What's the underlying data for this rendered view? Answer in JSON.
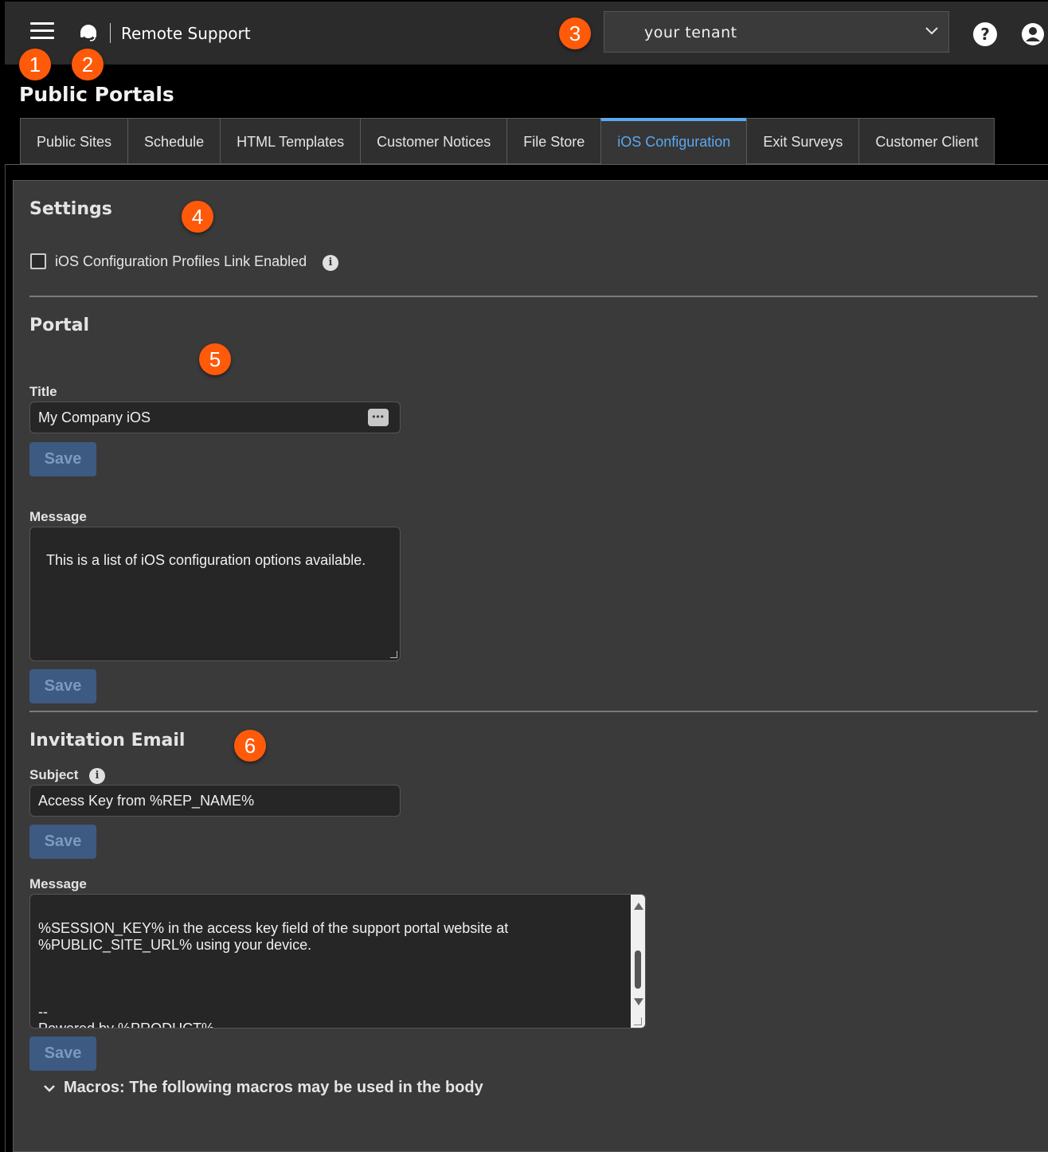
{
  "header": {
    "app_title": "Remote Support",
    "tenant": "your tenant",
    "help_icon": "?",
    "icons": [
      "menu-icon",
      "headset-logo-icon",
      "chevron-down-icon",
      "help-icon",
      "user-account-icon"
    ]
  },
  "badges": [
    "1",
    "2",
    "3",
    "4",
    "5",
    "6"
  ],
  "page": {
    "title": "Public Portals"
  },
  "tabs": [
    {
      "label": "Public Sites"
    },
    {
      "label": "Schedule"
    },
    {
      "label": "HTML Templates"
    },
    {
      "label": "Customer Notices"
    },
    {
      "label": "File Store"
    },
    {
      "label": "iOS Configuration",
      "active": true
    },
    {
      "label": "Exit Surveys"
    },
    {
      "label": "Customer Client"
    }
  ],
  "settings": {
    "heading": "Settings",
    "checkbox_label": "iOS Configuration Profiles Link Enabled",
    "checked": false
  },
  "portal": {
    "heading": "Portal",
    "title_label": "Title",
    "title_value": "My Company iOS",
    "message_label": "Message",
    "message_value": "This is a list of iOS configuration options available.",
    "save_label": "Save"
  },
  "invitation": {
    "heading": "Invitation Email",
    "subject_label": "Subject",
    "subject_value": "Access Key from %REP_NAME%",
    "message_label": "Message",
    "message_value": "%SESSION_KEY% in the access key field of the support portal website at\n%PUBLIC_SITE_URL% using your device.\n\n\n\n--\nPowered by %PRODUCT%\n%PRODUCT_URL%",
    "save_label": "Save"
  },
  "macros": {
    "label": "Macros: The following macros may be used in the body"
  },
  "colors": {
    "accent": "#5aa8f0",
    "badge": "#ff5a0a",
    "button": "#3c5a82"
  }
}
